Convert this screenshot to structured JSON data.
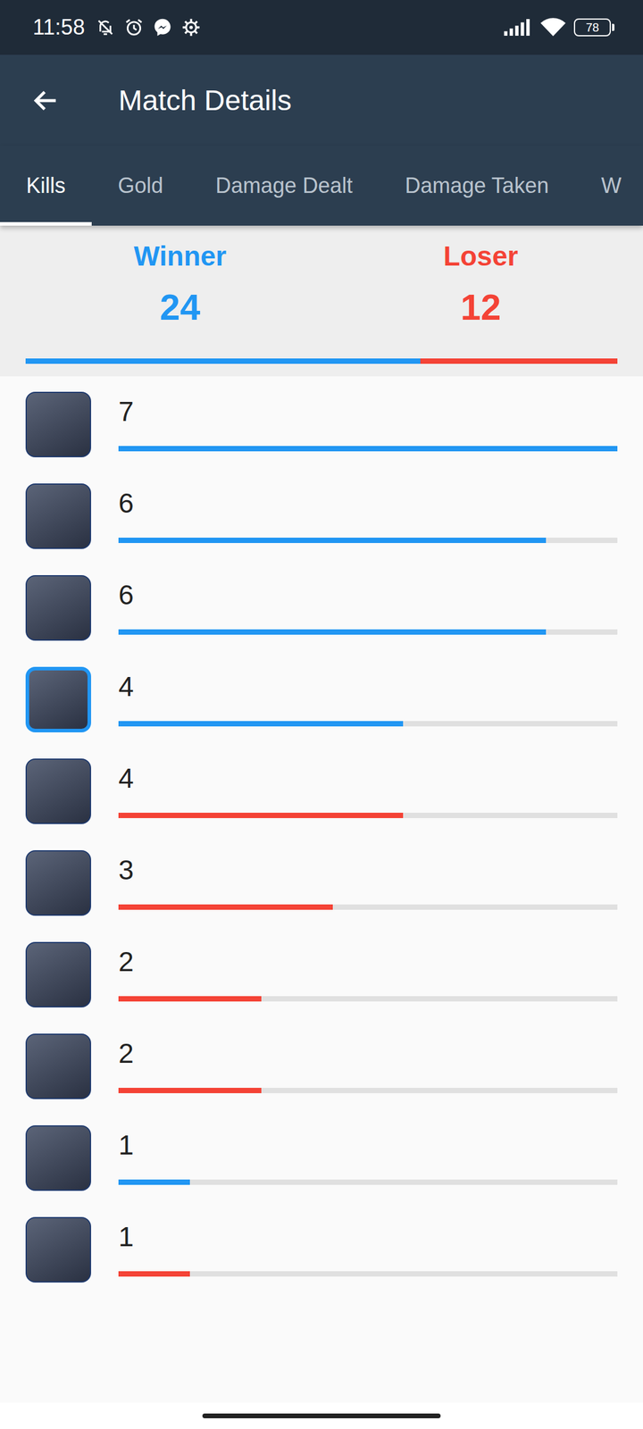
{
  "status_bar": {
    "time": "11:58",
    "battery": "78"
  },
  "header": {
    "title": "Match Details"
  },
  "tabs": [
    {
      "label": "Kills",
      "selected": true
    },
    {
      "label": "Gold",
      "selected": false
    },
    {
      "label": "Damage Dealt",
      "selected": false
    },
    {
      "label": "Damage Taken",
      "selected": false
    },
    {
      "label": "W",
      "selected": false
    }
  ],
  "summary": {
    "winner": {
      "label": "Winner",
      "kills": "24",
      "color": "#2196f3"
    },
    "loser": {
      "label": "Loser",
      "kills": "12",
      "color": "#f44336"
    },
    "level": 0.667
  },
  "players": [
    {
      "kills": "7",
      "level": 1.0,
      "color": "#2196f3",
      "highlighted": false
    },
    {
      "kills": "6",
      "level": 0.857,
      "color": "#2196f3",
      "highlighted": false
    },
    {
      "kills": "6",
      "level": 0.857,
      "color": "#2196f3",
      "highlighted": false
    },
    {
      "kills": "4",
      "level": 0.571,
      "color": "#2196f3",
      "highlighted": true
    },
    {
      "kills": "4",
      "level": 0.571,
      "color": "#f44336",
      "highlighted": false
    },
    {
      "kills": "3",
      "level": 0.429,
      "color": "#f44336",
      "highlighted": false
    },
    {
      "kills": "2",
      "level": 0.286,
      "color": "#f44336",
      "highlighted": false
    },
    {
      "kills": "2",
      "level": 0.286,
      "color": "#f44336",
      "highlighted": false
    },
    {
      "kills": "1",
      "level": 0.143,
      "color": "#2196f3",
      "highlighted": false
    },
    {
      "kills": "1",
      "level": 0.143,
      "color": "#f44336",
      "highlighted": false
    }
  ]
}
